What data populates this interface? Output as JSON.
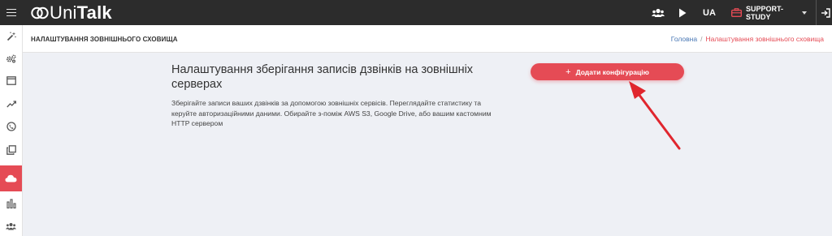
{
  "topbar": {
    "logo_prefix": "Uni",
    "logo_suffix": "Talk",
    "language": "UA",
    "account": "SUPPORT-STUDY",
    "icons": [
      "menu-icon",
      "users-icon",
      "play-icon",
      "briefcase-icon",
      "chevron-down-icon",
      "logout-icon"
    ]
  },
  "sidebar": {
    "items": [
      {
        "icon": "magic-wand-icon"
      },
      {
        "icon": "gears-icon"
      },
      {
        "icon": "window-icon"
      },
      {
        "icon": "trend-up-icon"
      },
      {
        "icon": "phone-clock-icon"
      },
      {
        "icon": "copy-icon"
      },
      {
        "icon": "cloud-icon",
        "active": true
      },
      {
        "icon": "bar-chart-icon"
      },
      {
        "icon": "team-icon"
      }
    ]
  },
  "header": {
    "title": "НАЛАШТУВАННЯ ЗОВНІШНЬОГО СХОВИЩА",
    "breadcrumb_home": "Головна",
    "breadcrumb_sep": "/",
    "breadcrumb_current": "Налаштування зовнішнього сховища"
  },
  "content": {
    "title": "Налаштування зберігання записів дзвінків на зовнішніх серверах",
    "description": "Зберігайте записи ваших дзвінків за допомогою зовнішніх сервісів. Переглядайте статистику та керуйте авторизаційними даними. Обирайте з-поміж AWS S3, Google Drive, або вашим кастомним HTTP сервером",
    "add_button_plus": "+",
    "add_button_label": "Додати конфігурацію"
  },
  "colors": {
    "accent": "#e54b55",
    "topbar": "#2c2c2c",
    "background": "#eef0f5",
    "annotation_arrow": "#e0262e"
  }
}
